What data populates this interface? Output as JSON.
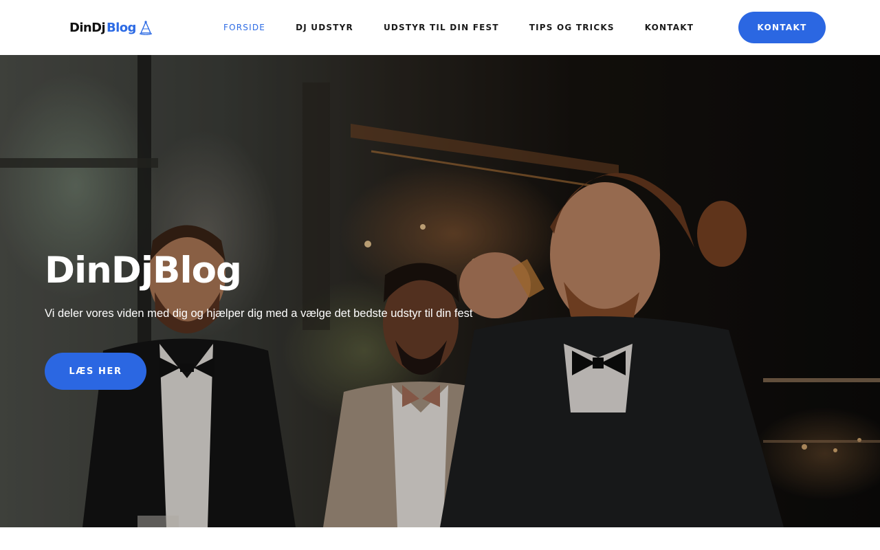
{
  "header": {
    "logo": {
      "part1": "DinDj",
      "part2": "Blog",
      "icon": "party-hat-icon"
    },
    "nav": [
      {
        "label": "FORSIDE",
        "active": true
      },
      {
        "label": "DJ UDSTYR",
        "active": false
      },
      {
        "label": "UDSTYR TIL DIN FEST",
        "active": false
      },
      {
        "label": "TIPS OG TRICKS",
        "active": false
      },
      {
        "label": "KONTAKT",
        "active": false
      }
    ],
    "cta_label": "KONTAKT"
  },
  "hero": {
    "title": "DinDjBlog",
    "subtitle": "Vi deler vores viden med dig og hjælper dig med a vælge det bedste udstyr til din fest",
    "button_label": "LÆS HER",
    "image": "party-photo-three-men-in-suits"
  },
  "colors": {
    "accent": "#2b67e2",
    "nav_text": "#1a1a1a",
    "hero_text": "#ffffff"
  }
}
